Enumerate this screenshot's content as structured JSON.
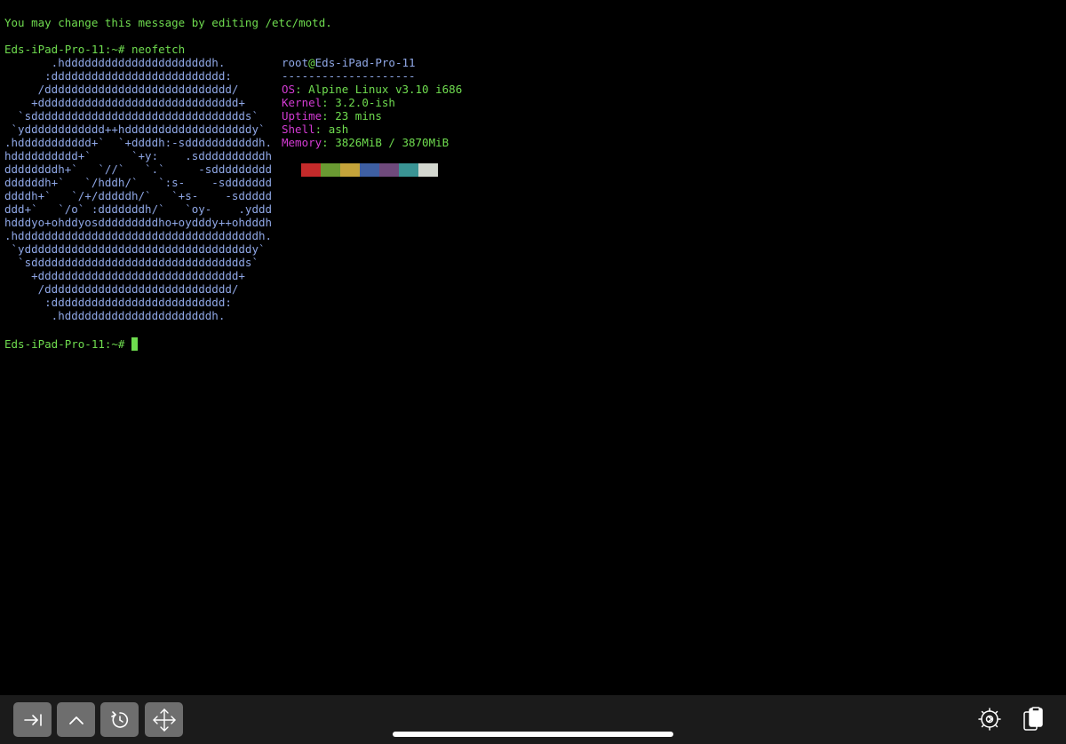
{
  "terminal": {
    "motd": "You may change this message by editing /etc/motd.",
    "prompt": "Eds-iPad-Pro-11:~#",
    "command": "neofetch",
    "ascii_logo": [
      "       .hddddddddddddddddddddddh.",
      "      :dddddddddddddddddddddddddd:",
      "     /dddddddddddddddddddddddddddd/",
      "    +dddddddddddddddddddddddddddddd+",
      "  `sdddddddddddddddddddddddddddddddds`",
      " `ydddddddddddd++hdddddddddddddddddddy`",
      ".hddddddddddd+`  `+ddddh:-sdddddddddddh.",
      "hdddddddddd+`      `+y:    .sddddddddddh",
      "ddddddddh+`   `//`   `.`     -sddddddddd",
      "ddddddh+`   `/hddh/`   `:s-    -sddddddd",
      "ddddh+`   `/+/dddddh/`   `+s-    -sddddd",
      "ddd+`   `/o` :dddddddh/`   `oy-    .yddd",
      "hdddyo+ohddyosdddddddddho+oydddy++ohdddh",
      ".hddddddddddddddddddddddddddddddddddddh.",
      " `yddddddddddddddddddddddddddddddddddy`",
      "  `sdddddddddddddddddddddddddddddddds`",
      "    +dddddddddddddddddddddddddddddd+",
      "     /dddddddddddddddddddddddddddd/",
      "      :dddddddddddddddddddddddddd:",
      "       .hddddddddddddddddddddddh."
    ],
    "info": {
      "user": "root",
      "at": "@",
      "host": "Eds-iPad-Pro-11",
      "separator": "--------------------",
      "rows": [
        {
          "key": "OS",
          "value": "Alpine Linux v3.10 i686"
        },
        {
          "key": "Kernel",
          "value": "3.2.0-ish"
        },
        {
          "key": "Uptime",
          "value": "23 mins"
        },
        {
          "key": "Shell",
          "value": "ash"
        },
        {
          "key": "Memory",
          "value": "3826MiB / 3870MiB"
        }
      ],
      "colon": ": "
    },
    "palette": [
      "#c42a2a",
      "#6a9a32",
      "#c4a33a",
      "#3e5fa2",
      "#6f4a7c",
      "#3a9494",
      "#d3d7cf"
    ],
    "final_prompt": "Eds-iPad-Pro-11:~#"
  },
  "toolbar": {
    "left_buttons": [
      {
        "name": "tab-key-button",
        "icon": "tab-arrow-icon"
      },
      {
        "name": "control-key-button",
        "icon": "chevron-up-icon"
      },
      {
        "name": "escape-key-button",
        "icon": "rotate-icon"
      },
      {
        "name": "arrow-keys-button",
        "icon": "move-arrows-icon"
      }
    ],
    "right_buttons": [
      {
        "name": "settings-button",
        "icon": "gear-icon"
      },
      {
        "name": "paste-button",
        "icon": "paste-icon"
      }
    ]
  }
}
